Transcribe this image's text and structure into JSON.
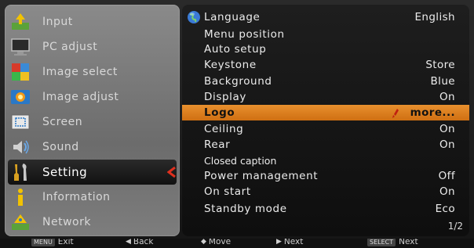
{
  "left_menu": {
    "items": [
      {
        "label": "Input",
        "icon": "input-icon"
      },
      {
        "label": "PC adjust",
        "icon": "pc-adjust-icon"
      },
      {
        "label": "Image select",
        "icon": "image-select-icon"
      },
      {
        "label": "Image adjust",
        "icon": "image-adjust-icon"
      },
      {
        "label": "Screen",
        "icon": "screen-icon"
      },
      {
        "label": "Sound",
        "icon": "sound-icon"
      },
      {
        "label": "Setting",
        "icon": "setting-icon"
      },
      {
        "label": "Information",
        "icon": "information-icon"
      },
      {
        "label": "Network",
        "icon": "network-icon"
      }
    ],
    "selected": "Setting"
  },
  "settings": {
    "rows": [
      {
        "name": "Language",
        "value": "English"
      },
      {
        "name": "Menu position",
        "value": ""
      },
      {
        "name": "Auto setup",
        "value": ""
      },
      {
        "name": "Keystone",
        "value": "Store"
      },
      {
        "name": "Background",
        "value": "Blue"
      },
      {
        "name": "Display",
        "value": "On"
      },
      {
        "name": "Logo",
        "value": "more..."
      },
      {
        "name": "Ceiling",
        "value": "On"
      },
      {
        "name": "Rear",
        "value": "On"
      },
      {
        "name": "Closed caption",
        "value": ""
      },
      {
        "name": "Power management",
        "value": "Off"
      },
      {
        "name": "On start",
        "value": "On"
      },
      {
        "name": "Standby mode",
        "value": "Eco"
      }
    ],
    "highlighted": "Logo",
    "page": "1/2"
  },
  "bottom_bar": {
    "hints": [
      {
        "key": "MENU",
        "glyph": "",
        "label": "Exit"
      },
      {
        "key": "",
        "glyph": "◀",
        "label": "Back"
      },
      {
        "key": "",
        "glyph": "◆",
        "label": "Move"
      },
      {
        "key": "",
        "glyph": "▶",
        "label": "Next"
      },
      {
        "key": "SELECT",
        "glyph": "",
        "label": "Next"
      }
    ]
  },
  "colors": {
    "highlight": "#e07f1f",
    "selected_arrow": "#e0301e",
    "panel_left": "#7a7a7a",
    "panel_right": "#151515"
  }
}
